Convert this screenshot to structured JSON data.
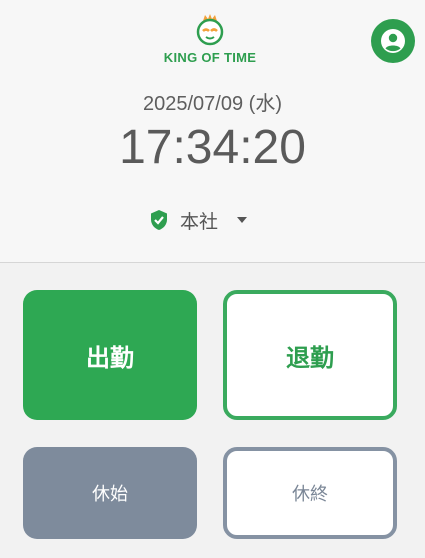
{
  "logo": {
    "text": "KING OF TIME"
  },
  "user": {
    "icon": "account-circle-icon"
  },
  "clock": {
    "date": "2025/07/09 (水)",
    "time": "17:34:20"
  },
  "location": {
    "icon": "verified-shield-icon",
    "label": "本社",
    "dropdown_icon": "caret-down-icon"
  },
  "buttons": {
    "clock_in": "出勤",
    "clock_out": "退勤",
    "break_start": "休始",
    "break_end": "休終"
  },
  "colors": {
    "brand_green": "#2ea853",
    "break_gray": "#7e8b9c",
    "background": "#f2f2f2"
  }
}
